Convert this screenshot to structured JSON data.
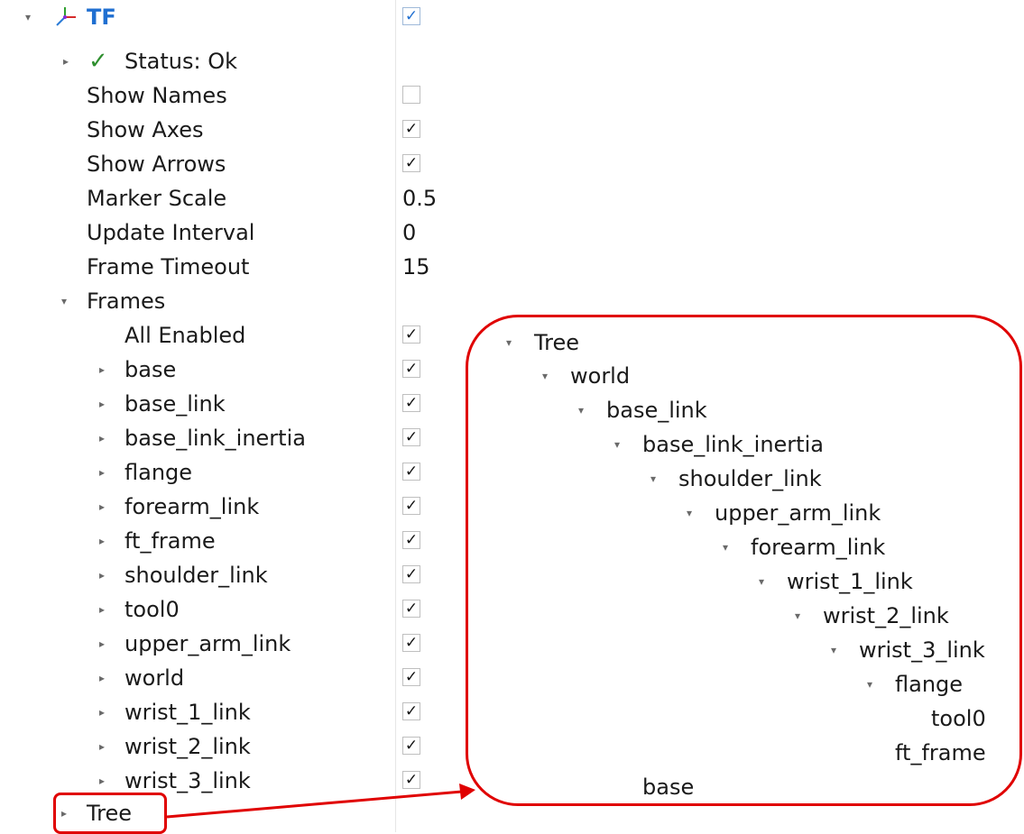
{
  "panel": {
    "tf": {
      "label": "TF",
      "checked": true
    },
    "status": {
      "label": "Status: Ok"
    },
    "properties": [
      {
        "label": "Show Names",
        "kind": "checkbox",
        "checked": false
      },
      {
        "label": "Show Axes",
        "kind": "checkbox",
        "checked": true
      },
      {
        "label": "Show Arrows",
        "kind": "checkbox",
        "checked": true
      },
      {
        "label": "Marker Scale",
        "kind": "value",
        "value": "0.5"
      },
      {
        "label": "Update Interval",
        "kind": "value",
        "value": "0"
      },
      {
        "label": "Frame Timeout",
        "kind": "value",
        "value": "15"
      }
    ],
    "frames": {
      "label": "Frames",
      "all_enabled": {
        "label": "All Enabled",
        "checked": true
      },
      "items": [
        {
          "label": "base",
          "checked": true
        },
        {
          "label": "base_link",
          "checked": true
        },
        {
          "label": "base_link_inertia",
          "checked": true
        },
        {
          "label": "flange",
          "checked": true
        },
        {
          "label": "forearm_link",
          "checked": true
        },
        {
          "label": "ft_frame",
          "checked": true
        },
        {
          "label": "shoulder_link",
          "checked": true
        },
        {
          "label": "tool0",
          "checked": true
        },
        {
          "label": "upper_arm_link",
          "checked": true
        },
        {
          "label": "world",
          "checked": true
        },
        {
          "label": "wrist_1_link",
          "checked": true
        },
        {
          "label": "wrist_2_link",
          "checked": true
        },
        {
          "label": "wrist_3_link",
          "checked": true
        }
      ]
    },
    "tree_label": "Tree"
  },
  "tree": {
    "root": "Tree",
    "nodes": [
      {
        "label": "world",
        "depth": 1,
        "expanded": true
      },
      {
        "label": "base_link",
        "depth": 2,
        "expanded": true
      },
      {
        "label": "base_link_inertia",
        "depth": 3,
        "expanded": true
      },
      {
        "label": "shoulder_link",
        "depth": 4,
        "expanded": true
      },
      {
        "label": "upper_arm_link",
        "depth": 5,
        "expanded": true
      },
      {
        "label": "forearm_link",
        "depth": 6,
        "expanded": true
      },
      {
        "label": "wrist_1_link",
        "depth": 7,
        "expanded": true
      },
      {
        "label": "wrist_2_link",
        "depth": 8,
        "expanded": true
      },
      {
        "label": "wrist_3_link",
        "depth": 9,
        "expanded": true
      },
      {
        "label": "flange",
        "depth": 10,
        "expanded": true
      },
      {
        "label": "tool0",
        "depth": 11,
        "expanded": false
      },
      {
        "label": "ft_frame",
        "depth": 10,
        "expanded": false
      },
      {
        "label": "base",
        "depth": 3,
        "expanded": false
      }
    ]
  },
  "colors": {
    "accent": "#1f6fd1",
    "status_ok": "#2f8f2f",
    "annotation": "#e00000"
  },
  "icons": {
    "expanded": "▾",
    "collapsed": "▸",
    "check": "✓",
    "tf": "tf-axes-icon"
  }
}
